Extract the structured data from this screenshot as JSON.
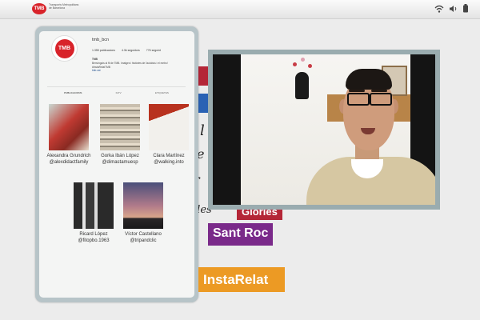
{
  "header": {
    "brand_logo_text": "TMB",
    "brand_name": "Transports Metropolitans de Barcelona"
  },
  "profile": {
    "avatar_text": "TMB",
    "username": "tmb_bcn",
    "stats": [
      "1.355 publicacions",
      "4.3k seguidors",
      "776 seguint"
    ],
    "bio_title": "TMB",
    "bio_lines": [
      "Benvinguts al fil de TMB. Imatges i històries de l'autobús i el metro!",
      "#InstaRelatTMB"
    ],
    "bio_link": "tmb.cat",
    "tabs": [
      "PUBLICACIONS",
      "IGTV",
      "ETIQUETES"
    ]
  },
  "feed": [
    {
      "author": "Alexandra Grundrich",
      "handle": "@alexdidactfamily"
    },
    {
      "author": "Gorka Ibán López",
      "handle": "@dimastamuesp"
    },
    {
      "author": "Clara Martínez",
      "handle": "@walking.into"
    },
    {
      "author": "Ricard López",
      "handle": "@fitopbo.1963"
    },
    {
      "author": "Víctor Castellano",
      "handle": "@tripandclic"
    }
  ],
  "backdrop": {
    "tags": [
      "Glòries",
      "Sant Roc"
    ],
    "banner": "InstaRelat"
  },
  "colors": {
    "tmb_red": "#d8232a",
    "banner_orange": "#ec9a24",
    "tag_purple": "#7a2a8a",
    "tag_crimson": "#b42637",
    "tag_blue": "#2a62b4"
  },
  "icons": [
    "wifi-icon",
    "speaker-icon",
    "battery-icon"
  ]
}
